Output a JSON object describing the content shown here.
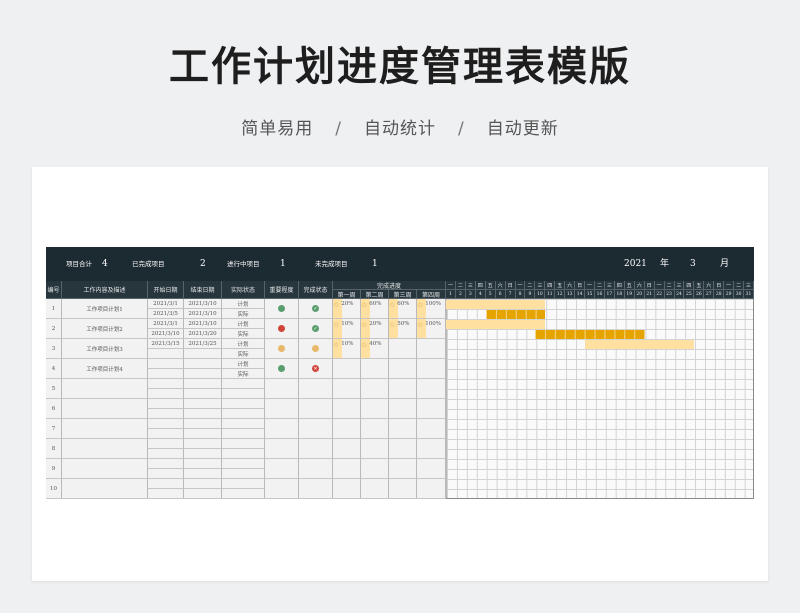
{
  "header": {
    "title": "工作计划进度管理表模版",
    "tags": [
      "简单易用",
      "自动统计",
      "自动更新"
    ],
    "separator": "/"
  },
  "summary": {
    "total_label": "项目合计",
    "total_value": "4",
    "done_label": "已完成项目",
    "done_value": "2",
    "doing_label": "进行中项目",
    "doing_value": "1",
    "todo_label": "未完成项目",
    "todo_value": "1",
    "year": "2021",
    "year_unit": "年",
    "month": "3",
    "month_unit": "月"
  },
  "columns": {
    "no": "编号",
    "content": "工作内容及描述",
    "start": "开始日期",
    "end": "结束日期",
    "status": "实际状态",
    "importance": "重要程度",
    "done": "完成状态",
    "progress": "完成进度",
    "weeks": [
      "第一周",
      "第二周",
      "第三周",
      "第四周"
    ]
  },
  "weekdays": [
    "一",
    "二",
    "三",
    "四",
    "五",
    "六",
    "日",
    "一",
    "二",
    "三",
    "四",
    "五",
    "六",
    "日",
    "一",
    "二",
    "三",
    "四",
    "五",
    "六",
    "日",
    "一",
    "二",
    "三",
    "四",
    "五",
    "六",
    "日",
    "一",
    "二",
    "三"
  ],
  "days": [
    "1",
    "2",
    "3",
    "4",
    "5",
    "6",
    "7",
    "8",
    "9",
    "10",
    "11",
    "12",
    "13",
    "14",
    "15",
    "16",
    "17",
    "18",
    "19",
    "20",
    "21",
    "22",
    "23",
    "24",
    "25",
    "26",
    "27",
    "28",
    "29",
    "30",
    "31"
  ],
  "rows": [
    {
      "no": "1",
      "name": "工作项目计划1",
      "plan_start": "2021/3/1",
      "plan_end": "2021/3/10",
      "act_start": "2021/3/5",
      "act_end": "2021/3/10",
      "plan_label": "计划",
      "act_label": "实际",
      "importance_color": "#5a9e6f",
      "done_state": "check",
      "done_color": "#5a9e6f",
      "progress": [
        "20%",
        "60%",
        "60%",
        "100%"
      ],
      "plan_days": [
        1,
        10
      ],
      "act_days": [
        5,
        10
      ]
    },
    {
      "no": "2",
      "name": "工作项目计划2",
      "plan_start": "2021/3/1",
      "plan_end": "2021/3/10",
      "act_start": "2021/3/10",
      "act_end": "2021/3/20",
      "plan_label": "计划",
      "act_label": "实际",
      "importance_color": "#d0453a",
      "done_state": "check",
      "done_color": "#5a9e6f",
      "progress": [
        "10%",
        "20%",
        "50%",
        "100%"
      ],
      "plan_days": [
        1,
        10
      ],
      "act_days": [
        10,
        20
      ]
    },
    {
      "no": "3",
      "name": "工作项目计划3",
      "plan_start": "2021/3/15",
      "plan_end": "2021/3/25",
      "act_start": "",
      "act_end": "",
      "plan_label": "计划",
      "act_label": "实际",
      "importance_color": "#e8b86a",
      "done_state": "half",
      "done_color": "#e8b86a",
      "progress": [
        "10%",
        "40%",
        "",
        ""
      ],
      "plan_days": [
        15,
        25
      ],
      "act_days": null
    },
    {
      "no": "4",
      "name": "工作项目计划4",
      "plan_start": "",
      "plan_end": "",
      "act_start": "",
      "act_end": "",
      "plan_label": "计划",
      "act_label": "实际",
      "importance_color": "#5a9e6f",
      "done_state": "cross",
      "done_color": "#d0453a",
      "progress": [
        "",
        "",
        "",
        ""
      ],
      "plan_days": null,
      "act_days": null
    },
    {
      "no": "5"
    },
    {
      "no": "6"
    },
    {
      "no": "7"
    },
    {
      "no": "8"
    },
    {
      "no": "9"
    },
    {
      "no": "10"
    }
  ],
  "colors": {
    "dark": "#1c2a31",
    "plan_bar": "#ffe0a0",
    "act_bar": "#e6a400"
  }
}
